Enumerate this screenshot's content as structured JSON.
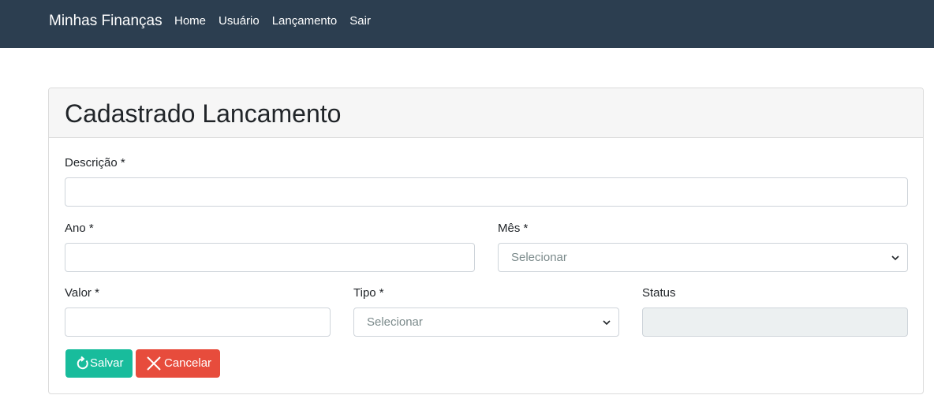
{
  "navbar": {
    "brand": "Minhas Finanças",
    "links": [
      "Home",
      "Usuário",
      "Lançamento",
      "Sair"
    ]
  },
  "card": {
    "title": "Cadastrado Lancamento"
  },
  "form": {
    "descricao": {
      "label": "Descrição *",
      "value": ""
    },
    "ano": {
      "label": "Ano *",
      "value": ""
    },
    "mes": {
      "label": "Mês *",
      "selected": "Selecionar"
    },
    "valor": {
      "label": "Valor *",
      "value": ""
    },
    "tipo": {
      "label": "Tipo *",
      "selected": "Selecionar"
    },
    "status": {
      "label": "Status",
      "value": ""
    }
  },
  "buttons": {
    "save": {
      "label": "Salvar",
      "icon": "refresh-icon",
      "color": "#18bc9c"
    },
    "cancel": {
      "label": "Cancelar",
      "icon": "close-icon",
      "color": "#e74c3c"
    }
  },
  "colors": {
    "navbar": "#2c3e50",
    "disabled_field": "#ecf0f1"
  }
}
